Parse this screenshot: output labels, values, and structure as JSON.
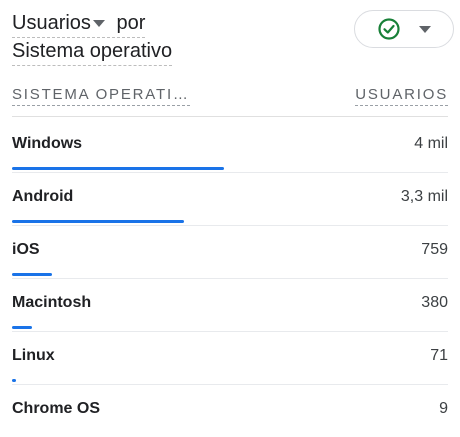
{
  "card": {
    "metric_label": "Usuarios",
    "by_label": "por",
    "dimension_label": "Sistema operativo"
  },
  "status": {
    "icon": "check-circle-icon",
    "color": "#188038"
  },
  "table": {
    "col_dimension": "SISTEMA OPERATI…",
    "col_metric": "USUARIOS",
    "accent": "#1a73e8",
    "rows": [
      {
        "label": "Windows",
        "value": "4 mil",
        "share": 1.0
      },
      {
        "label": "Android",
        "value": "3,3 mil",
        "share": 0.81
      },
      {
        "label": "iOS",
        "value": "759",
        "share": 0.19
      },
      {
        "label": "Macintosh",
        "value": "380",
        "share": 0.095
      },
      {
        "label": "Linux",
        "value": "71",
        "share": 0.018
      },
      {
        "label": "Chrome OS",
        "value": "9",
        "share": 0.0
      }
    ]
  }
}
